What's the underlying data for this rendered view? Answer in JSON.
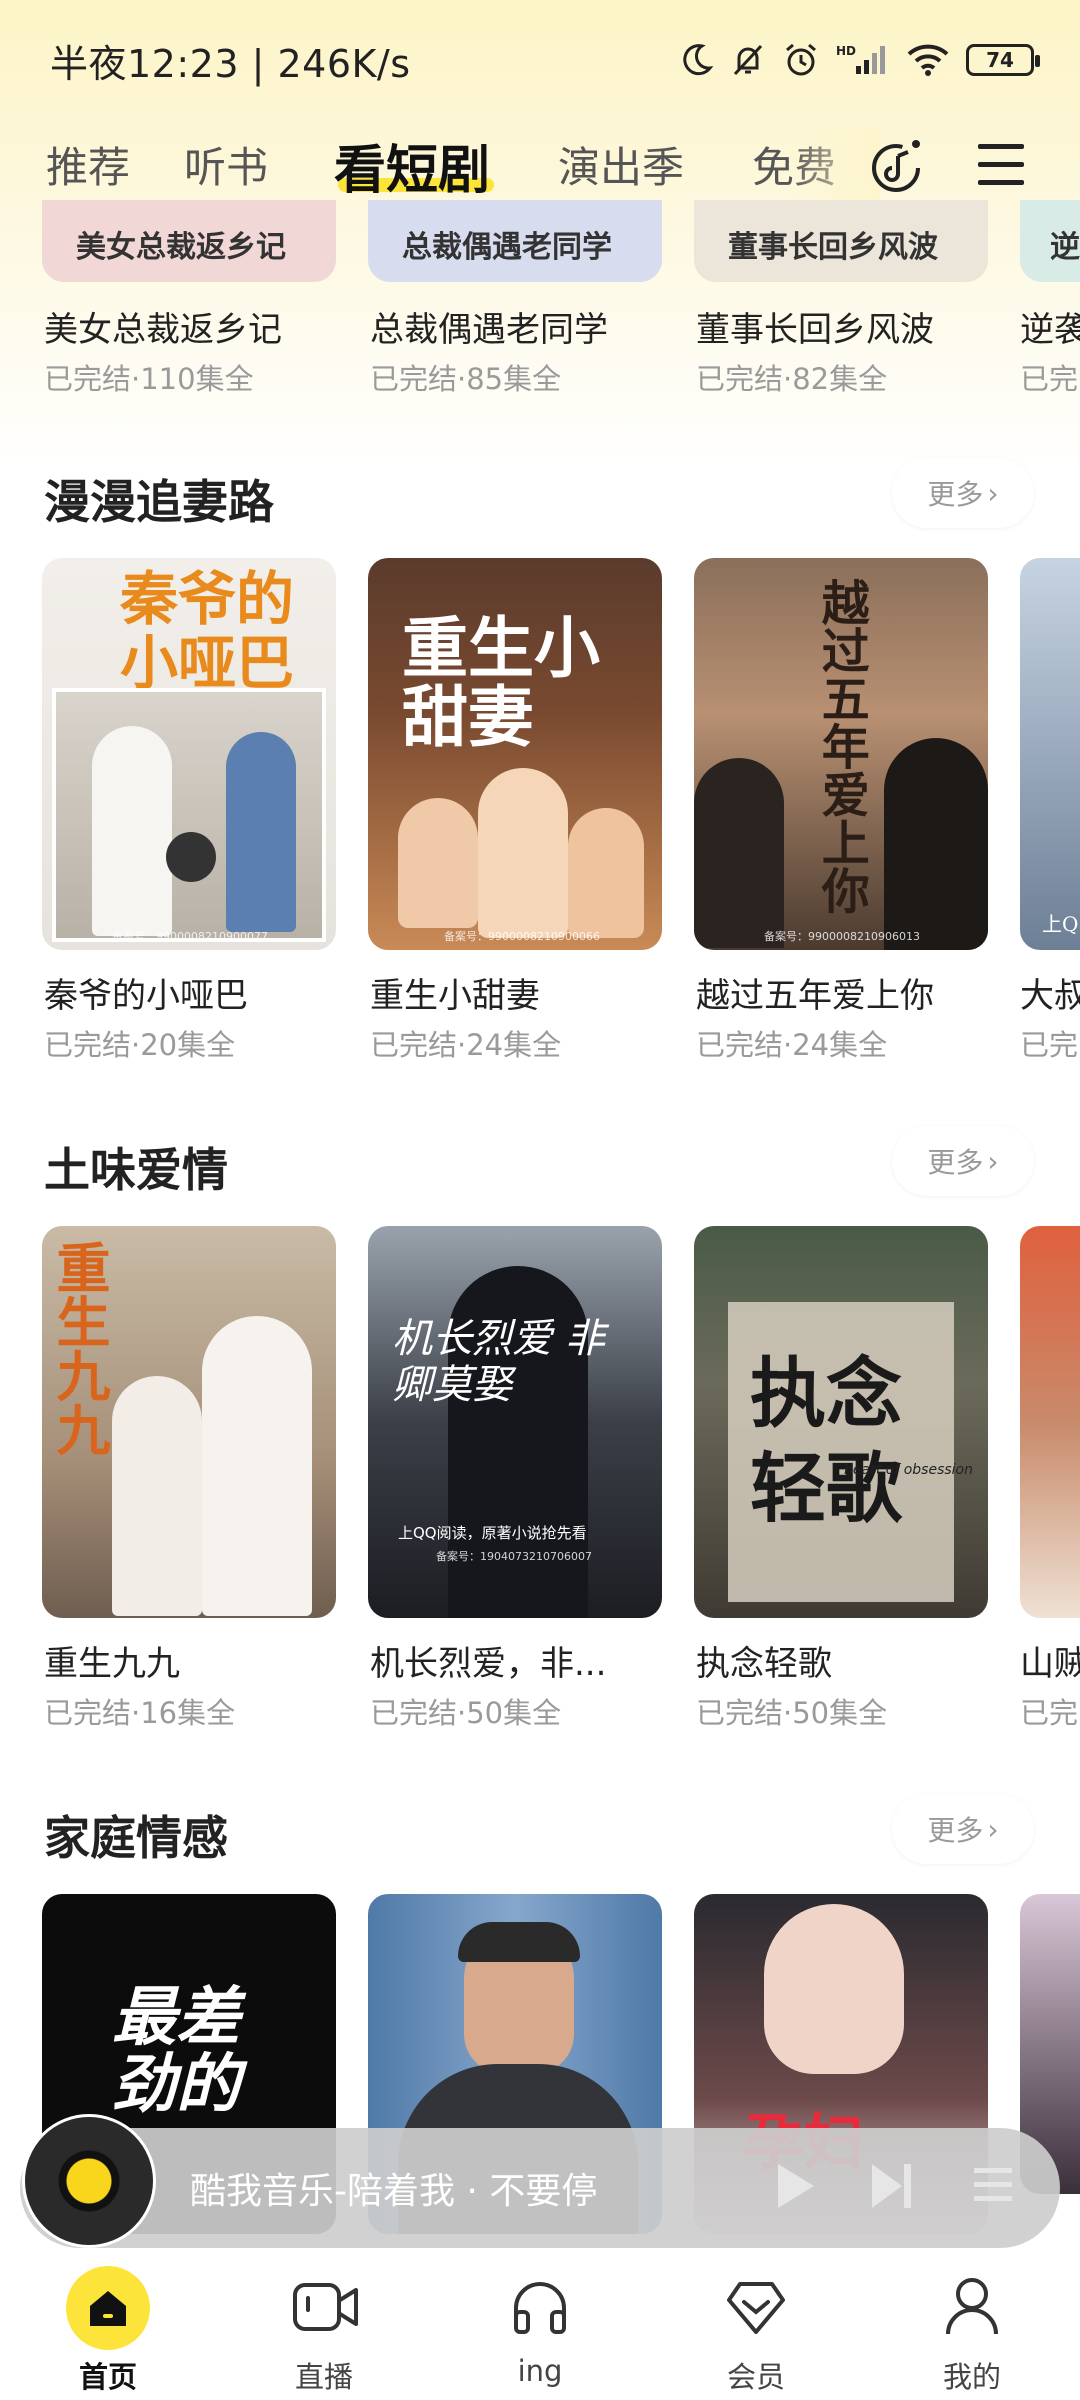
{
  "status": {
    "time": "半夜12:23 | 246K/s",
    "battery": "74"
  },
  "tabs": [
    {
      "label": "推荐"
    },
    {
      "label": "听书"
    },
    {
      "label": "看短剧"
    },
    {
      "label": "演出季"
    },
    {
      "label": "免费"
    }
  ],
  "top_row": [
    {
      "title": "美女总裁返乡记",
      "meta": "已完结·110集全",
      "banner": "美女总裁返乡记"
    },
    {
      "title": "总裁偶遇老同学",
      "meta": "已完结·85集全",
      "banner": "总裁偶遇老同学"
    },
    {
      "title": "董事长回乡风波",
      "meta": "已完结·82集全",
      "banner": "董事长回乡风波"
    },
    {
      "title": "逆袭",
      "meta": "已完",
      "banner": "逆"
    }
  ],
  "sections": [
    {
      "title": "漫漫追妻路",
      "more": "更多",
      "items": [
        {
          "title": "秦爷的小哑巴",
          "meta": "已完结·20集全",
          "poster_text": "秦爷的小哑巴",
          "record": "备案号：9900008210900077"
        },
        {
          "title": "重生小甜妻",
          "meta": "已完结·24集全",
          "poster_text": "重生小甜妻",
          "record": "备案号：9900008210900066"
        },
        {
          "title": "越过五年爱上你",
          "meta": "已完结·24集全",
          "poster_text": "越过五年爱上你",
          "record": "备案号：9900008210906013"
        },
        {
          "title": "大叔",
          "meta": "已完",
          "poster_text": "上Q"
        }
      ]
    },
    {
      "title": "土味爱情",
      "more": "更多",
      "items": [
        {
          "title": "重生九九",
          "meta": "已完结·16集全",
          "poster_text": "重生九九"
        },
        {
          "title": "机长烈爱，非...",
          "meta": "已完结·50集全",
          "poster_text": "机长烈爱 非卿莫娶",
          "note": "上QQ阅读，原著小说抢先看",
          "record": "备案号：1904073210706007"
        },
        {
          "title": "执念轻歌",
          "meta": "已完结·50集全",
          "poster_text": "执念轻歌",
          "subtitle": "heart of obsession"
        },
        {
          "title": "山贼",
          "meta": "已完"
        }
      ]
    },
    {
      "title": "家庭情感",
      "more": "更多",
      "items": [
        {
          "poster_text": "最差劲的"
        },
        {
          "poster_text": ""
        },
        {
          "poster_text": "孕妇"
        },
        {
          "poster_text": ""
        }
      ]
    }
  ],
  "player": {
    "track": "酷我音乐-陪着我 · 不要停"
  },
  "bottom_nav": [
    {
      "label": "首页",
      "icon": "home-icon"
    },
    {
      "label": "直播",
      "icon": "video-icon"
    },
    {
      "label": "ing",
      "icon": "headphones-icon"
    },
    {
      "label": "会员",
      "icon": "vip-diamond-icon"
    },
    {
      "label": "我的",
      "icon": "profile-icon"
    }
  ],
  "colors": {
    "accent": "#fde43a",
    "muted": "#9a9a9a"
  }
}
